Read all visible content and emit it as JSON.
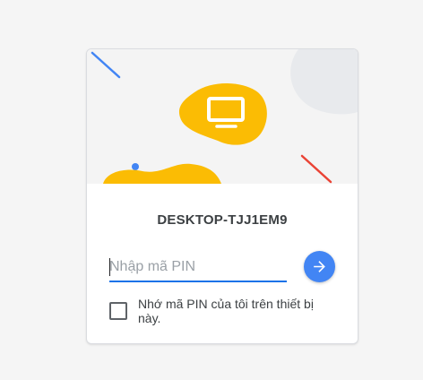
{
  "host": {
    "name": "DESKTOP-TJJ1EM9"
  },
  "pin_form": {
    "pin_value": "",
    "pin_placeholder": "Nhập mã PIN",
    "submit_icon": "arrow-right-icon",
    "remember_label": "Nhớ mã PIN của tôi trên thiết bị này.",
    "remember_checked": false
  },
  "hero": {
    "icon": "monitor-icon"
  },
  "colors": {
    "accent": "#4285f4",
    "input_underline": "#1a73e8",
    "blob_yellow": "#fbbc04",
    "line_red": "#ea4335",
    "line_blue": "#4285f4"
  }
}
